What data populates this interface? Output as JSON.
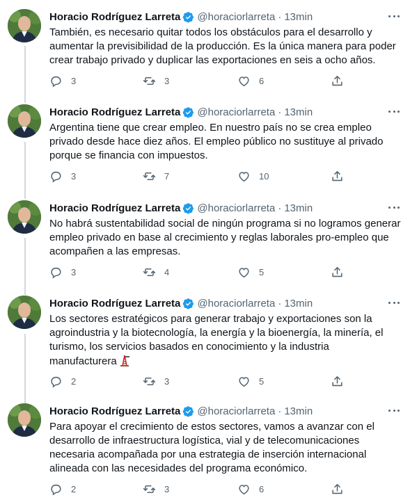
{
  "tweets": [
    {
      "author": "Horacio Rodríguez Larreta",
      "handle": "@horaciorlarreta",
      "dot": "·",
      "time": "13min",
      "lines": [
        "También, es necesario quitar todos los obstáculos para el desarrollo y",
        "aumentar la previsibilidad de la producción. Es la única manera para poder",
        "crear trabajo privado y duplicar las exportaciones en seis a ocho años."
      ],
      "replies": "3",
      "retweets": "3",
      "likes": "6"
    },
    {
      "author": "Horacio Rodríguez Larreta",
      "handle": "@horaciorlarreta",
      "dot": "·",
      "time": "13min",
      "lines": [
        "Argentina tiene que crear empleo. En nuestro país no se crea empleo",
        "privado desde hace diez años. El empleo público no sustituye al privado",
        "porque se financia con impuestos."
      ],
      "replies": "3",
      "retweets": "7",
      "likes": "10"
    },
    {
      "author": "Horacio Rodríguez Larreta",
      "handle": "@horaciorlarreta",
      "dot": "·",
      "time": "13min",
      "lines": [
        "No habrá sustentabilidad social de ningún programa si no logramos generar",
        "empleo privado en base al crecimiento y reglas laborales pro-empleo que",
        "acompañen a las empresas."
      ],
      "replies": "3",
      "retweets": "4",
      "likes": "5"
    },
    {
      "author": "Horacio Rodríguez Larreta",
      "handle": "@horaciorlarreta",
      "dot": "·",
      "time": "13min",
      "lines": [
        "Los sectores estratégicos para generar trabajo y exportaciones son la",
        "agroindustria y la biotecnología, la energía y la bioenergía, la minería, el",
        "turismo, los servicios basados en conocimiento y la industria",
        "manufacturera"
      ],
      "emoji": "oil-derrick-emoji",
      "replies": "2",
      "retweets": "3",
      "likes": "5"
    },
    {
      "author": "Horacio Rodríguez Larreta",
      "handle": "@horaciorlarreta",
      "dot": "·",
      "time": "13min",
      "lines": [
        "Para apoyar el crecimiento de estos sectores, vamos a avanzar con el",
        "desarrollo de infraestructura logística, vial y de telecomunicaciones",
        "necesaria acompañada por una estrategia de inserción internacional",
        "alineada con las necesidades del programa económico."
      ],
      "replies": "2",
      "retweets": "3",
      "likes": "6"
    }
  ],
  "icons": {
    "reply": "reply-icon",
    "retweet": "retweet-icon",
    "like": "like-icon",
    "share": "share-icon",
    "more": "more-icon",
    "verified": "verified-badge-icon"
  },
  "colors": {
    "text": "#0f1419",
    "secondary": "#536471",
    "verified": "#1d9bf0",
    "thread_line": "#cfd9de"
  }
}
